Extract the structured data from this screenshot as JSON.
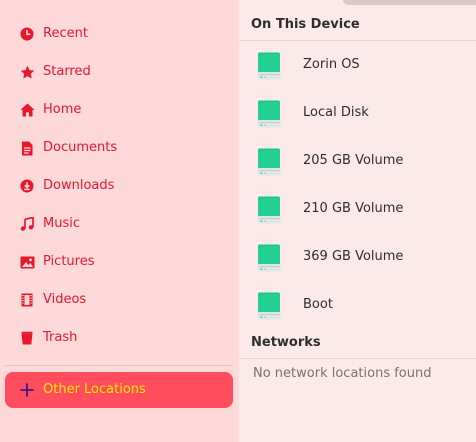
{
  "sidebar": {
    "items": [
      {
        "label": "Recent",
        "icon": "clock-icon"
      },
      {
        "label": "Starred",
        "icon": "star-icon"
      },
      {
        "label": "Home",
        "icon": "home-icon"
      },
      {
        "label": "Documents",
        "icon": "document-icon"
      },
      {
        "label": "Downloads",
        "icon": "download-icon"
      },
      {
        "label": "Music",
        "icon": "music-icon"
      },
      {
        "label": "Pictures",
        "icon": "picture-icon"
      },
      {
        "label": "Videos",
        "icon": "video-icon"
      },
      {
        "label": "Trash",
        "icon": "trash-icon"
      }
    ],
    "other_locations": {
      "label": "Other Locations",
      "icon": "plus-icon",
      "active": true
    }
  },
  "main": {
    "on_this_device": {
      "title": "On This Device",
      "devices": [
        {
          "label": "Zorin OS",
          "icon": "drive-icon"
        },
        {
          "label": "Local Disk",
          "icon": "drive-icon"
        },
        {
          "label": "205 GB Volume",
          "icon": "drive-icon"
        },
        {
          "label": "210 GB Volume",
          "icon": "drive-icon"
        },
        {
          "label": "369 GB Volume",
          "icon": "drive-icon"
        },
        {
          "label": "Boot",
          "icon": "drive-icon"
        }
      ]
    },
    "networks": {
      "title": "Networks",
      "empty_text": "No network locations found"
    }
  },
  "colors": {
    "accent": "#e8182c",
    "active_bg": "#ff4d5e",
    "active_text": "#ffe800",
    "drive_green": "#1ec48a"
  }
}
